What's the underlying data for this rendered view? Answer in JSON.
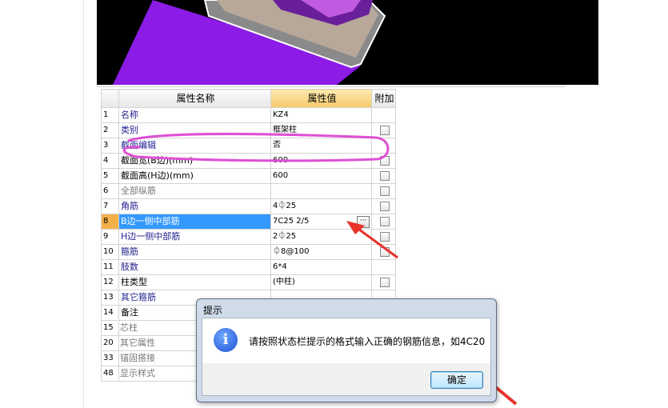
{
  "grid": {
    "headers": {
      "name": "属性名称",
      "value": "属性值",
      "extra": "附加"
    },
    "rows": [
      {
        "num": "1",
        "name": "名称",
        "value": "KZ4",
        "check": false,
        "style": "blue",
        "expand": false,
        "selected": false
      },
      {
        "num": "2",
        "name": "类别",
        "value": "框架柱",
        "check": true,
        "style": "blue",
        "expand": false,
        "selected": false
      },
      {
        "num": "3",
        "name": "截面编辑",
        "value": "否",
        "check": false,
        "style": "blue",
        "expand": false,
        "selected": false
      },
      {
        "num": "4",
        "name": "截面宽(B边)(mm)",
        "value": "600",
        "check": true,
        "style": "black",
        "expand": false,
        "selected": false
      },
      {
        "num": "5",
        "name": "截面高(H边)(mm)",
        "value": "600",
        "check": true,
        "style": "black",
        "expand": false,
        "selected": false
      },
      {
        "num": "6",
        "name": "全部纵筋",
        "value": "",
        "check": true,
        "style": "gray",
        "expand": false,
        "selected": false
      },
      {
        "num": "7",
        "name": "角筋",
        "value": "4⏀25",
        "check": true,
        "style": "blue",
        "expand": false,
        "selected": false
      },
      {
        "num": "8",
        "name": "B边一侧中部筋",
        "value": "7C25 2/5",
        "check": true,
        "style": "blue",
        "expand": false,
        "selected": true,
        "ellipsis": "···"
      },
      {
        "num": "9",
        "name": "H边一侧中部筋",
        "value": "2⏀25",
        "check": true,
        "style": "blue",
        "expand": false,
        "selected": false
      },
      {
        "num": "10",
        "name": "箍筋",
        "value": "⏀8@100",
        "check": true,
        "style": "blue",
        "expand": false,
        "selected": false
      },
      {
        "num": "11",
        "name": "肢数",
        "value": "6*4",
        "check": false,
        "style": "blue",
        "expand": false,
        "selected": false
      },
      {
        "num": "12",
        "name": "柱类型",
        "value": "(中柱)",
        "check": true,
        "style": "black",
        "expand": false,
        "selected": false
      },
      {
        "num": "13",
        "name": "其它箍筋",
        "value": "",
        "check": false,
        "style": "blue",
        "expand": false,
        "selected": false
      },
      {
        "num": "14",
        "name": "备注",
        "value": "",
        "check": false,
        "style": "black",
        "expand": false,
        "selected": false
      },
      {
        "num": "15",
        "name": "芯柱",
        "value": "",
        "check": false,
        "style": "gray",
        "expand": true,
        "selected": false
      },
      {
        "num": "20",
        "name": "其它属性",
        "value": "",
        "check": false,
        "style": "gray",
        "expand": true,
        "selected": false
      },
      {
        "num": "33",
        "name": "锚固搭接",
        "value": "",
        "check": false,
        "style": "gray",
        "expand": true,
        "selected": false
      },
      {
        "num": "48",
        "name": "显示样式",
        "value": "",
        "check": false,
        "style": "gray",
        "expand": true,
        "selected": false
      }
    ]
  },
  "dialog": {
    "title": "提示",
    "message": "请按照状态栏提示的格式输入正确的钢筋信息，如4C20",
    "ok_label": "确定",
    "icon": "info-icon"
  },
  "annotation_colors": {
    "highlight": "#e04fd4",
    "arrow": "#e8322a",
    "viewport_shape": "#8a1fe0"
  }
}
